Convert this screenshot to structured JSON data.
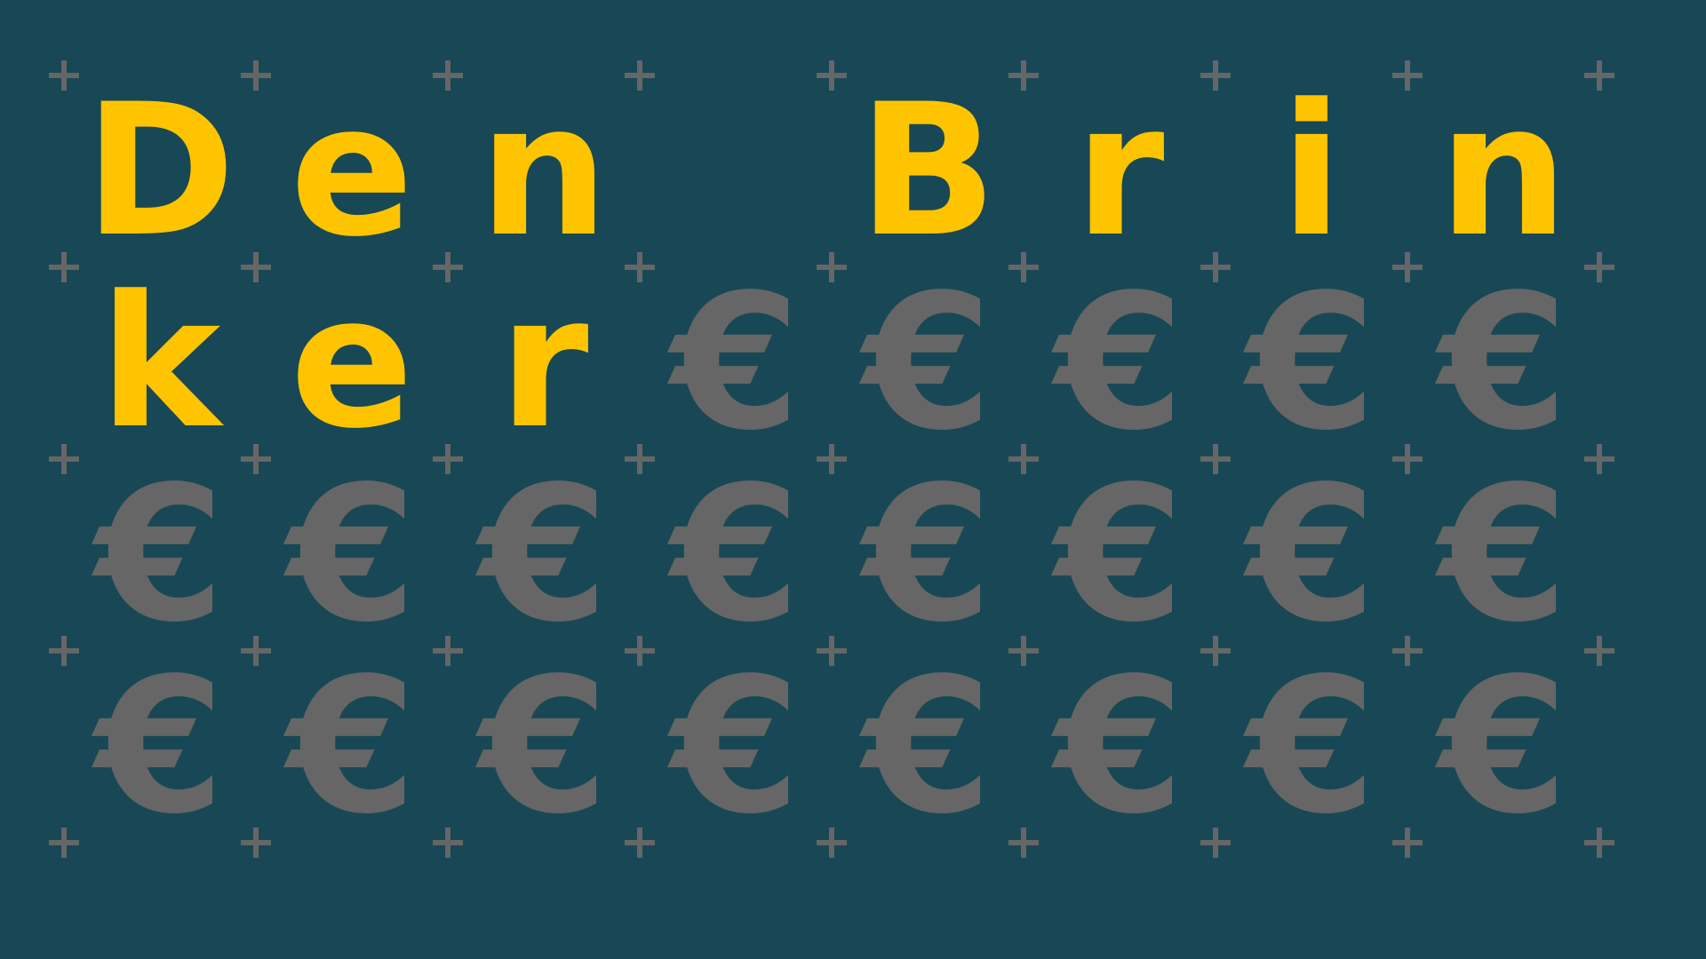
{
  "colors": {
    "background": "#184855",
    "letter": "#FFC400",
    "euro": "#666666",
    "plus": "#666666"
  },
  "grid": {
    "columns": 8,
    "rows": 4
  },
  "decoration": {
    "plus_icon": "plus-icon",
    "euro_icon": "euro-sign-icon"
  },
  "cells": [
    "D",
    "e",
    "n",
    "",
    "B",
    "r",
    "i",
    "n",
    "k",
    "e",
    "r",
    "€",
    "€",
    "€",
    "€",
    "€",
    "€",
    "€",
    "€",
    "€",
    "€",
    "€",
    "€",
    "€",
    "€",
    "€",
    "€",
    "€",
    "€",
    "€",
    "€",
    "€"
  ]
}
